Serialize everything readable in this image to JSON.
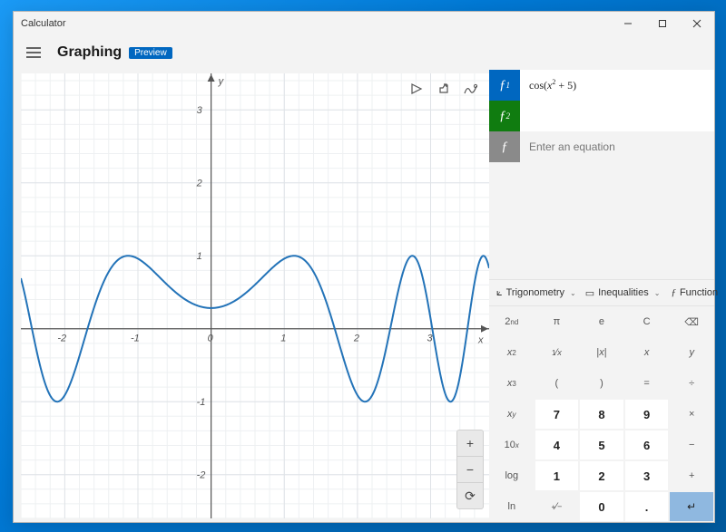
{
  "window_title": "Calculator",
  "header": {
    "mode": "Graphing",
    "badge": "Preview"
  },
  "graph": {
    "x_ticks": [
      "-2",
      "-1",
      "0",
      "1",
      "2",
      "3"
    ],
    "y_ticks": [
      "-2",
      "-1",
      "1",
      "2",
      "3"
    ],
    "x_axis_label": "x",
    "y_axis_label": "y",
    "tools": {
      "trace": "Trace",
      "share": "Share",
      "options": "Graph options"
    },
    "zoom": {
      "in": "+",
      "out": "−",
      "reset": "⟳"
    }
  },
  "equations": [
    {
      "swatch_label": "ƒ1",
      "color": "#0067c0",
      "text": "cos(x² + 5)",
      "plain": "cos(x^2 + 5)"
    },
    {
      "swatch_label": "ƒ2",
      "color": "#107c10",
      "text": ""
    },
    {
      "swatch_label": "ƒ",
      "color": "#8a8a8a",
      "placeholder": "Enter an equation"
    }
  ],
  "categories": {
    "trig_label": "Trigonometry",
    "ineq_label": "Inequalities",
    "func_label": "Function"
  },
  "keypad": [
    [
      {
        "l": "2ⁿᵈ",
        "c": "func"
      },
      {
        "l": "π",
        "c": "func"
      },
      {
        "l": "e",
        "c": "func"
      },
      {
        "l": "C",
        "c": "func"
      },
      {
        "l": "⌫",
        "c": "func"
      }
    ],
    [
      {
        "l": "x²",
        "c": "func"
      },
      {
        "l": "¹⁄ₓ",
        "c": "func"
      },
      {
        "l": "|x|",
        "c": "func"
      },
      {
        "l": "x",
        "c": "func",
        "i": true
      },
      {
        "l": "y",
        "c": "func",
        "i": true
      }
    ],
    [
      {
        "l": "x³",
        "c": "func"
      },
      {
        "l": "(",
        "c": "func"
      },
      {
        "l": ")",
        "c": "func"
      },
      {
        "l": "=",
        "c": "func"
      },
      {
        "l": "÷",
        "c": "func"
      }
    ],
    [
      {
        "l": "xʸ",
        "c": "func"
      },
      {
        "l": "7",
        "c": "num"
      },
      {
        "l": "8",
        "c": "num"
      },
      {
        "l": "9",
        "c": "num"
      },
      {
        "l": "×",
        "c": "func"
      }
    ],
    [
      {
        "l": "10ˣ",
        "c": "func"
      },
      {
        "l": "4",
        "c": "num"
      },
      {
        "l": "5",
        "c": "num"
      },
      {
        "l": "6",
        "c": "num"
      },
      {
        "l": "−",
        "c": "func"
      }
    ],
    [
      {
        "l": "log",
        "c": "func"
      },
      {
        "l": "1",
        "c": "num"
      },
      {
        "l": "2",
        "c": "num"
      },
      {
        "l": "3",
        "c": "num"
      },
      {
        "l": "+",
        "c": "func"
      }
    ],
    [
      {
        "l": "ln",
        "c": "func"
      },
      {
        "l": "⁺⁄₋",
        "c": "func"
      },
      {
        "l": "0",
        "c": "num"
      },
      {
        "l": ".",
        "c": "num"
      },
      {
        "l": "↵",
        "c": "accent"
      }
    ]
  ],
  "chart_data": {
    "type": "line",
    "title": "",
    "xlabel": "x",
    "ylabel": "y",
    "xlim": [
      -2.6,
      3.8
    ],
    "ylim": [
      -2.6,
      3.5
    ],
    "series": [
      {
        "name": "cos(x^2 + 5)",
        "color": "#2373b8",
        "formula": "cos(x*x + 5)",
        "x_sample_step": 0.01
      }
    ],
    "grid": {
      "minor_step": 0.2,
      "major_step": 1
    },
    "axes_at_origin": true
  }
}
